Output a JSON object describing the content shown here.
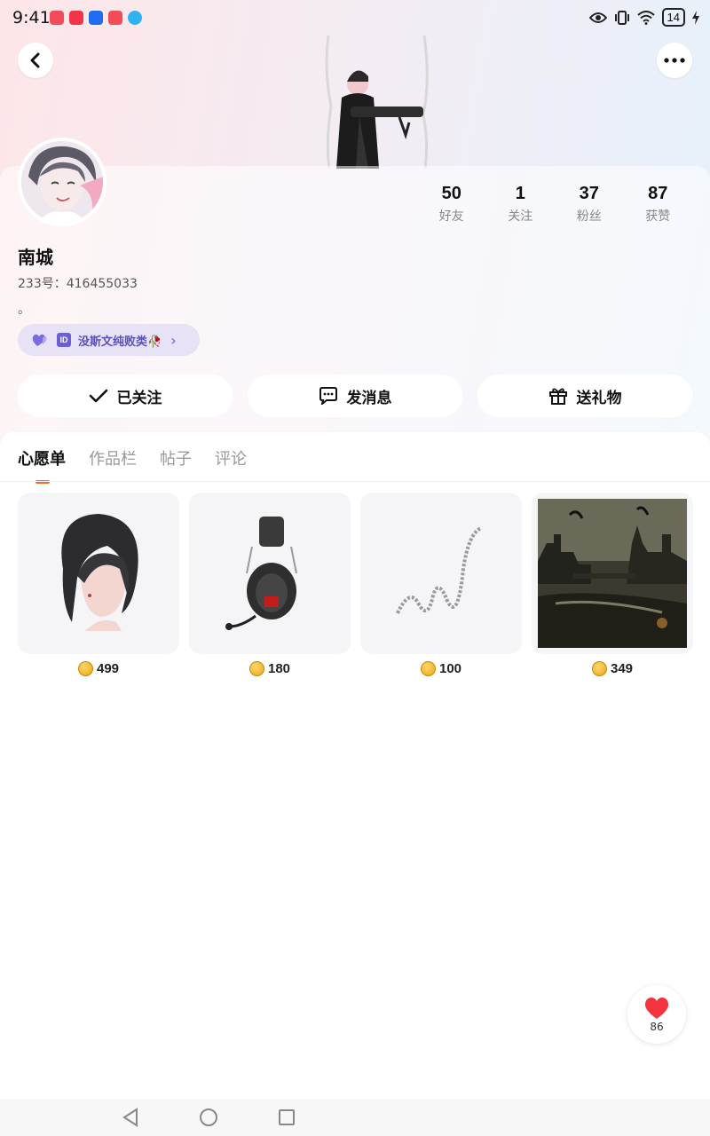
{
  "status_bar": {
    "time": "9:41",
    "battery": "14",
    "icons": [
      "eye-icon",
      "vibrate-icon",
      "wifi-icon",
      "battery-icon",
      "charging-icon"
    ]
  },
  "header": {
    "back_icon": "chevron-left-icon",
    "more_icon": "more-dots-icon"
  },
  "profile": {
    "name": "南城",
    "uid": "233号：416455033",
    "bio": "。",
    "tag": "没斯文纯败类🥀",
    "stats": [
      {
        "value": "50",
        "label": "好友"
      },
      {
        "value": "1",
        "label": "关注"
      },
      {
        "value": "37",
        "label": "粉丝"
      },
      {
        "value": "87",
        "label": "获赞"
      }
    ]
  },
  "actions": {
    "follow": "已关注",
    "message": "发消息",
    "gift": "送礼物"
  },
  "tabs": [
    "心愿单",
    "作品栏",
    "帖子",
    "评论"
  ],
  "wishlist": [
    {
      "item": "hair-accessory",
      "price": "499"
    },
    {
      "item": "headphones",
      "price": "180"
    },
    {
      "item": "chain",
      "price": "100"
    },
    {
      "item": "castle-background",
      "price": "349"
    }
  ],
  "like_fab": {
    "count": "86"
  },
  "colors": {
    "accent": "#f36b1c",
    "tag_text": "#5a4fc0",
    "tag_bg": "#e7e2f6"
  }
}
